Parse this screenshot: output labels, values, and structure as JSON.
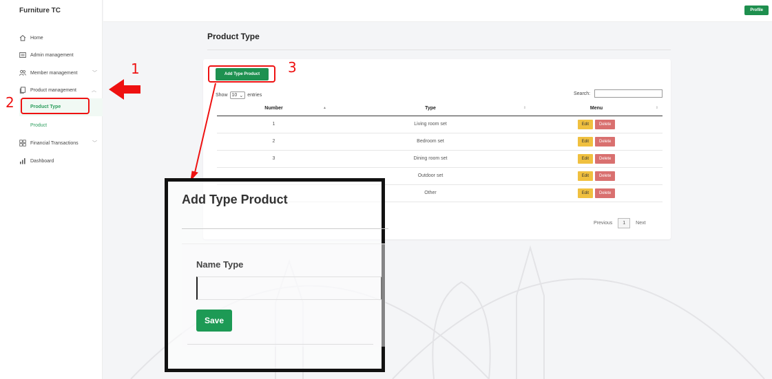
{
  "app": {
    "brand": "Furniture TC"
  },
  "topbar": {
    "profile_label": "Profile"
  },
  "sidebar": {
    "items": [
      {
        "label": "Home",
        "icon": "home-icon"
      },
      {
        "label": "Admin management",
        "icon": "admin-card-icon"
      },
      {
        "label": "Member management",
        "icon": "users-icon"
      },
      {
        "label": "Product management",
        "icon": "copy-icon"
      },
      {
        "label": "Financial Transactions",
        "icon": "grid-icon"
      },
      {
        "label": "Dashboard",
        "icon": "bar-chart-icon"
      }
    ],
    "sub_items": [
      {
        "label": "Product Type",
        "active": true
      },
      {
        "label": "Product",
        "active": false
      }
    ]
  },
  "main": {
    "title": "Product Type",
    "add_button": "Add Type Product",
    "show_label": "Show",
    "entries_value": "10",
    "entries_label": "entries",
    "search_label": "Search:",
    "columns": [
      "Number",
      "Type",
      "Menu"
    ],
    "rows": [
      {
        "number": "1",
        "type": "Living room set"
      },
      {
        "number": "2",
        "type": "Bedroom set"
      },
      {
        "number": "3",
        "type": "Dining room set"
      },
      {
        "number": "",
        "type": "Outdoor set"
      },
      {
        "number": "",
        "type": "Other"
      }
    ],
    "edit_label": "Edit",
    "delete_label": "Delete",
    "pager": {
      "previous": "Previous",
      "page": "1",
      "next": "Next"
    }
  },
  "annotations": {
    "n1": "1",
    "n2": "2",
    "n3": "3"
  },
  "modal": {
    "title": "Add Type Product",
    "field_label": "Name Type",
    "save_label": "Save"
  },
  "colors": {
    "accent": "#1e9150",
    "annotation": "#ee1111",
    "edit": "#f0c03f",
    "delete": "#d9706f"
  }
}
